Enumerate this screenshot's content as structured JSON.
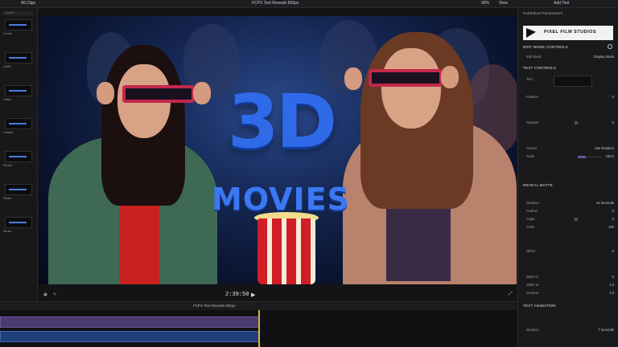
{
  "top_bar": {
    "left_label": "All Clips",
    "center_title": "FCPX Text Reveals 600px",
    "zoom": "99%",
    "view_label": "View",
    "inspector_title": "Add Text"
  },
  "browser": {
    "search_placeholder": "Search",
    "items": [
      {
        "label": "Create"
      },
      {
        "label": "Inside"
      },
      {
        "label": "Ostria"
      },
      {
        "label": "Outside"
      },
      {
        "label": "Reveal"
      },
      {
        "label": "Subtle"
      },
      {
        "label": "Stroke"
      }
    ]
  },
  "viewer": {
    "title_main": "3D",
    "title_sub": "MOVIES",
    "timecode": "2:39:50"
  },
  "timeline": {
    "project_name": "FCPX Text Reveals 600px"
  },
  "inspector": {
    "header": "Published Parameters",
    "brand": "PIXEL FILM STUDIOS",
    "sections": {
      "edit_mode": "EDIT MODE CONTROLS",
      "text_controls": "TEXT CONTROLS",
      "reveal_matte": "REVEAL MATTE",
      "text_animation": "TEXT ANIMATION"
    },
    "rows": [
      {
        "label": "Edit Mode",
        "value": "Display Mode"
      },
      {
        "label": "Text",
        "value": ""
      },
      {
        "label": "Position",
        "value": "0"
      },
      {
        "label": "Rotation",
        "value": "0"
      },
      {
        "label": "Anchor",
        "value": "Use Rotation"
      },
      {
        "label": "Scale",
        "value": "100.0"
      },
      {
        "label": "Duration",
        "value": "15 Seconds"
      },
      {
        "label": "Feather",
        "value": "0"
      },
      {
        "label": "Angle",
        "value": "0"
      },
      {
        "label": "Scale",
        "value": "100"
      },
      {
        "label": "Offset",
        "value": "0"
      },
      {
        "label": "Black In",
        "value": "0"
      },
      {
        "label": "White In",
        "value": "1.0"
      },
      {
        "label": "Gamma",
        "value": "1.0"
      },
      {
        "label": "Duration",
        "value": "7 Seconds"
      }
    ]
  }
}
